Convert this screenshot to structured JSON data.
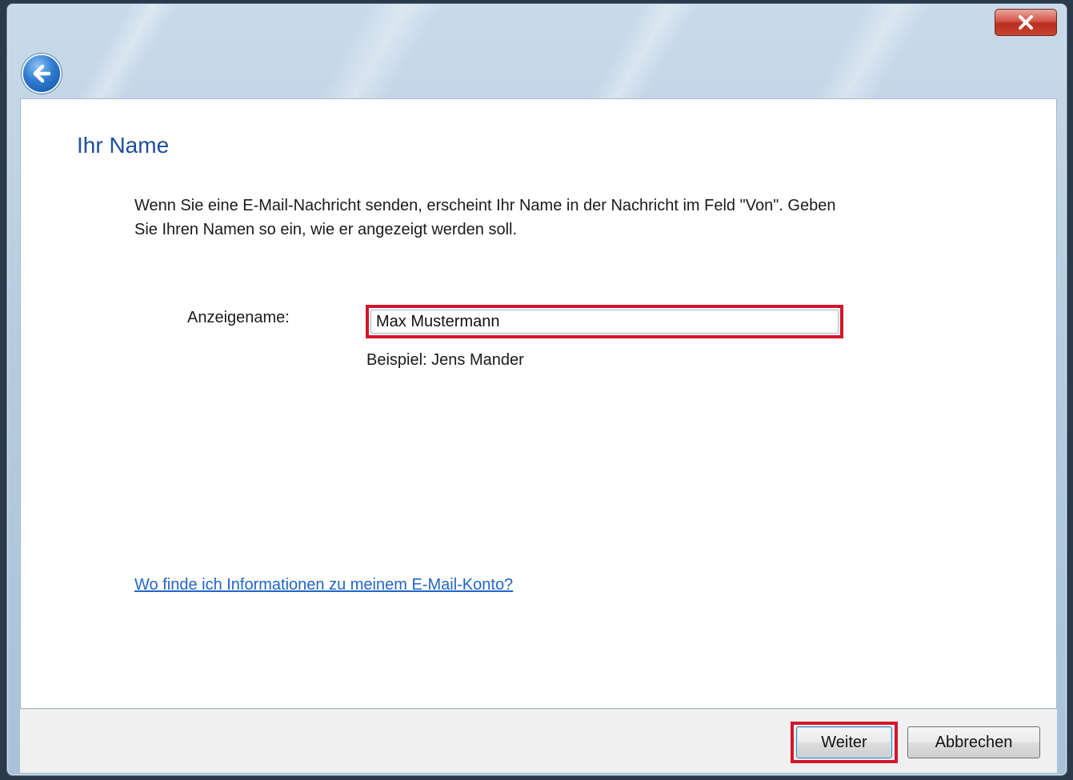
{
  "window": {
    "close_label": "X"
  },
  "page": {
    "title": "Ihr Name",
    "description": "Wenn Sie eine E-Mail-Nachricht senden, erscheint Ihr Name in der Nachricht im Feld \"Von\". Geben Sie Ihren Namen so ein, wie er angezeigt werden soll."
  },
  "form": {
    "display_name_label": "Anzeigename:",
    "display_name_value": "Max Mustermann",
    "example": "Beispiel: Jens Mander"
  },
  "help": {
    "link_text": "Wo finde ich Informationen zu meinem E-Mail-Konto?"
  },
  "buttons": {
    "next": "Weiter",
    "cancel": "Abbrechen"
  },
  "colors": {
    "title": "#1e4f9c",
    "link": "#2266c8",
    "highlight": "#d4152b",
    "close_button": "#c8452f"
  },
  "icons": {
    "back": "back-arrow-icon",
    "close": "close-icon"
  }
}
